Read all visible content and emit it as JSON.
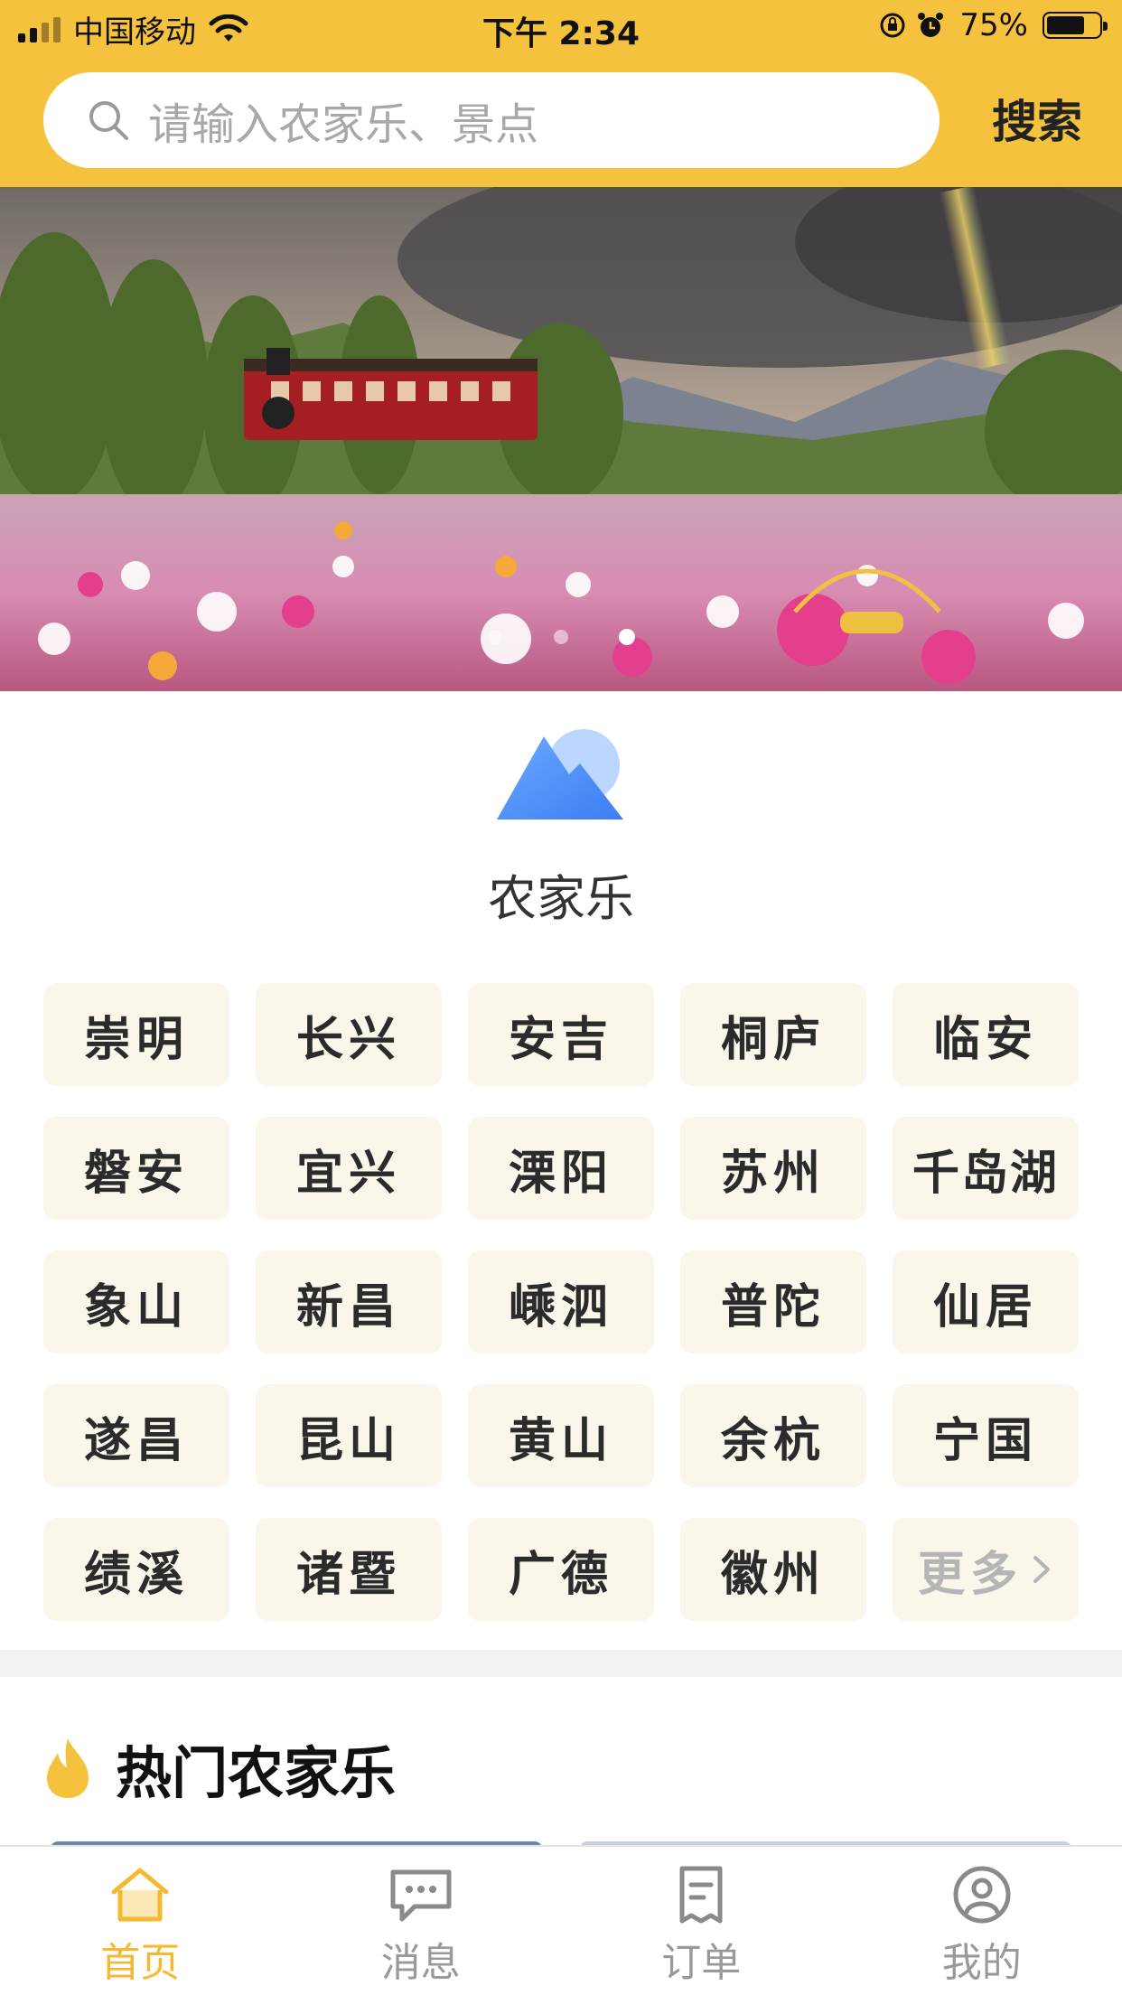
{
  "status_bar": {
    "carrier": "中国移动",
    "time": "下午 2:34",
    "battery": "75%",
    "battery_level": 0.75
  },
  "search": {
    "placeholder": "请输入农家乐、景点",
    "button_label": "搜索"
  },
  "banner": {
    "slide_count": 3,
    "active_slide": 2
  },
  "category": {
    "label": "农家乐",
    "icon": "mountain-icon"
  },
  "tags": [
    "崇明",
    "长兴",
    "安吉",
    "桐庐",
    "临安",
    "磐安",
    "宜兴",
    "溧阳",
    "苏州",
    "千岛湖",
    "象山",
    "新昌",
    "嵊泗",
    "普陀",
    "仙居",
    "遂昌",
    "昆山",
    "黄山",
    "余杭",
    "宁国",
    "绩溪",
    "诸暨",
    "广德",
    "徽州"
  ],
  "more_label": "更多",
  "hot_section": {
    "title": "热门农家乐",
    "icon": "flame-icon"
  },
  "tabbar": {
    "items": [
      {
        "label": "首页",
        "icon": "home-icon",
        "active": true
      },
      {
        "label": "消息",
        "icon": "message-icon",
        "active": false
      },
      {
        "label": "订单",
        "icon": "order-icon",
        "active": false
      },
      {
        "label": "我的",
        "icon": "profile-icon",
        "active": false
      }
    ]
  },
  "colors": {
    "accent": "#F5C23D",
    "tab_active": "#F5B92F",
    "tag_bg": "#FBF6EA"
  }
}
